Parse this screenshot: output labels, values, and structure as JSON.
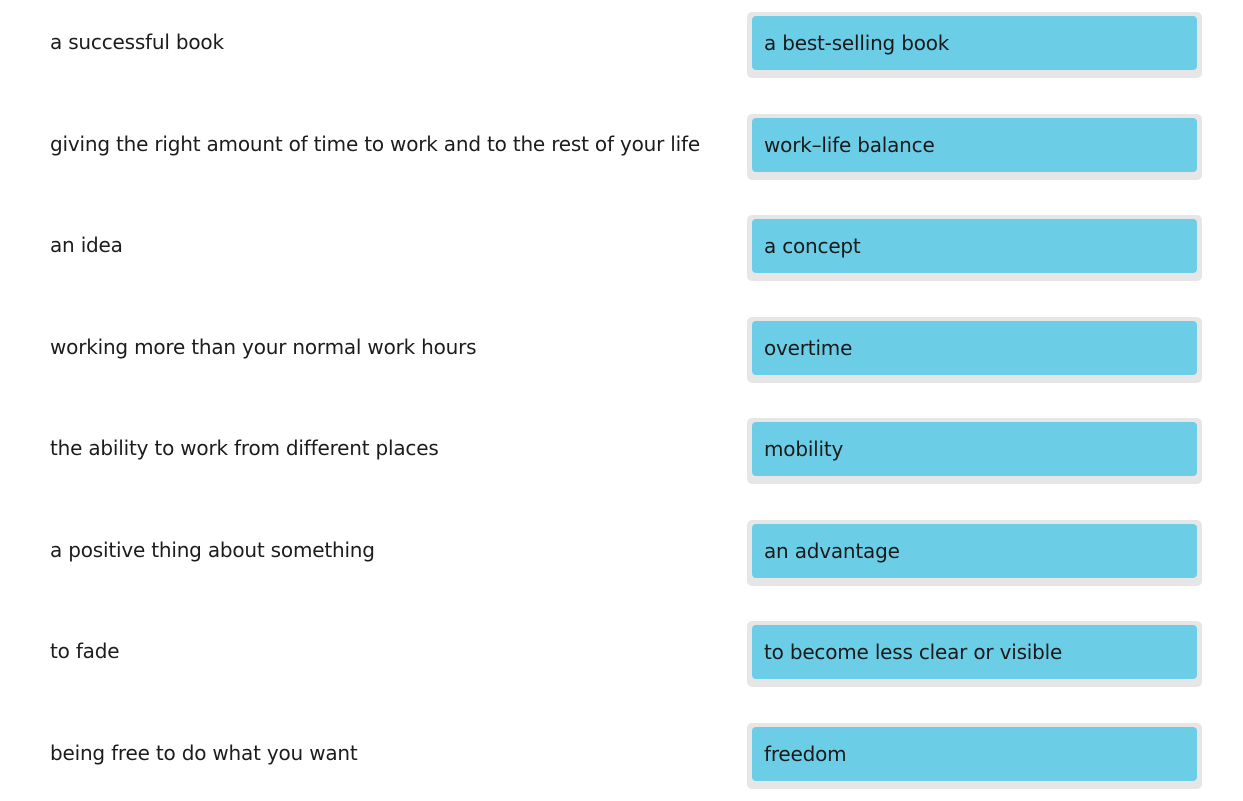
{
  "pairs": [
    {
      "prompt": "a successful book",
      "answer": "a best-selling book"
    },
    {
      "prompt": "giving the right amount of time to work and to the rest of your life",
      "answer": "work–life balance"
    },
    {
      "prompt": "an idea",
      "answer": "a concept"
    },
    {
      "prompt": "working more than your normal work hours",
      "answer": "overtime"
    },
    {
      "prompt": "the ability to work from different places",
      "answer": "mobility"
    },
    {
      "prompt": "a positive thing about something",
      "answer": "an advantage"
    },
    {
      "prompt": "to fade",
      "answer": "to become less clear or visible"
    },
    {
      "prompt": "being free to do what you want",
      "answer": "freedom"
    }
  ],
  "colors": {
    "answer_bg": "#6ccde7",
    "slot_bg": "#e6e6e6",
    "text": "#1a1a1a"
  }
}
